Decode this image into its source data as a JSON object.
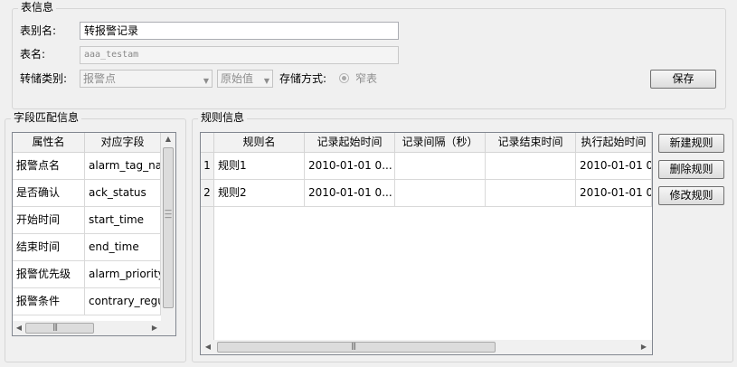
{
  "table_info": {
    "title": "表信息",
    "alias_label": "表别名:",
    "alias_value": "转报警记录",
    "name_label": "表名:",
    "name_value": "aaa_testam",
    "type_label": "转储类别:",
    "type_value": "报警点",
    "value_select": "原始值",
    "storage_label": "存储方式:",
    "storage_option": "窄表",
    "save_label": "保存"
  },
  "field_match": {
    "title": "字段匹配信息",
    "columns": [
      "属性名",
      "对应字段"
    ],
    "rows": [
      [
        "报警点名",
        "alarm_tag_na..."
      ],
      [
        "是否确认",
        "ack_status"
      ],
      [
        "开始时间",
        "start_time"
      ],
      [
        "结束时间",
        "end_time"
      ],
      [
        "报警优先级",
        "alarm_priority"
      ],
      [
        "报警条件",
        "contrary_regu"
      ]
    ]
  },
  "rule_info": {
    "title": "规则信息",
    "columns": [
      "规则名",
      "记录起始时间",
      "记录间隔（秒）",
      "记录结束时间",
      "执行起始时间"
    ],
    "rows": [
      {
        "num": "1",
        "cells": [
          "规则1",
          "2010-01-01 0...",
          "",
          "",
          "2010-01-01 0..."
        ]
      },
      {
        "num": "2",
        "cells": [
          "规则2",
          "2010-01-01 0...",
          "",
          "",
          "2010-01-01 0..."
        ]
      }
    ],
    "buttons": {
      "new": "新建规则",
      "delete": "删除规则",
      "modify": "修改规则"
    }
  }
}
